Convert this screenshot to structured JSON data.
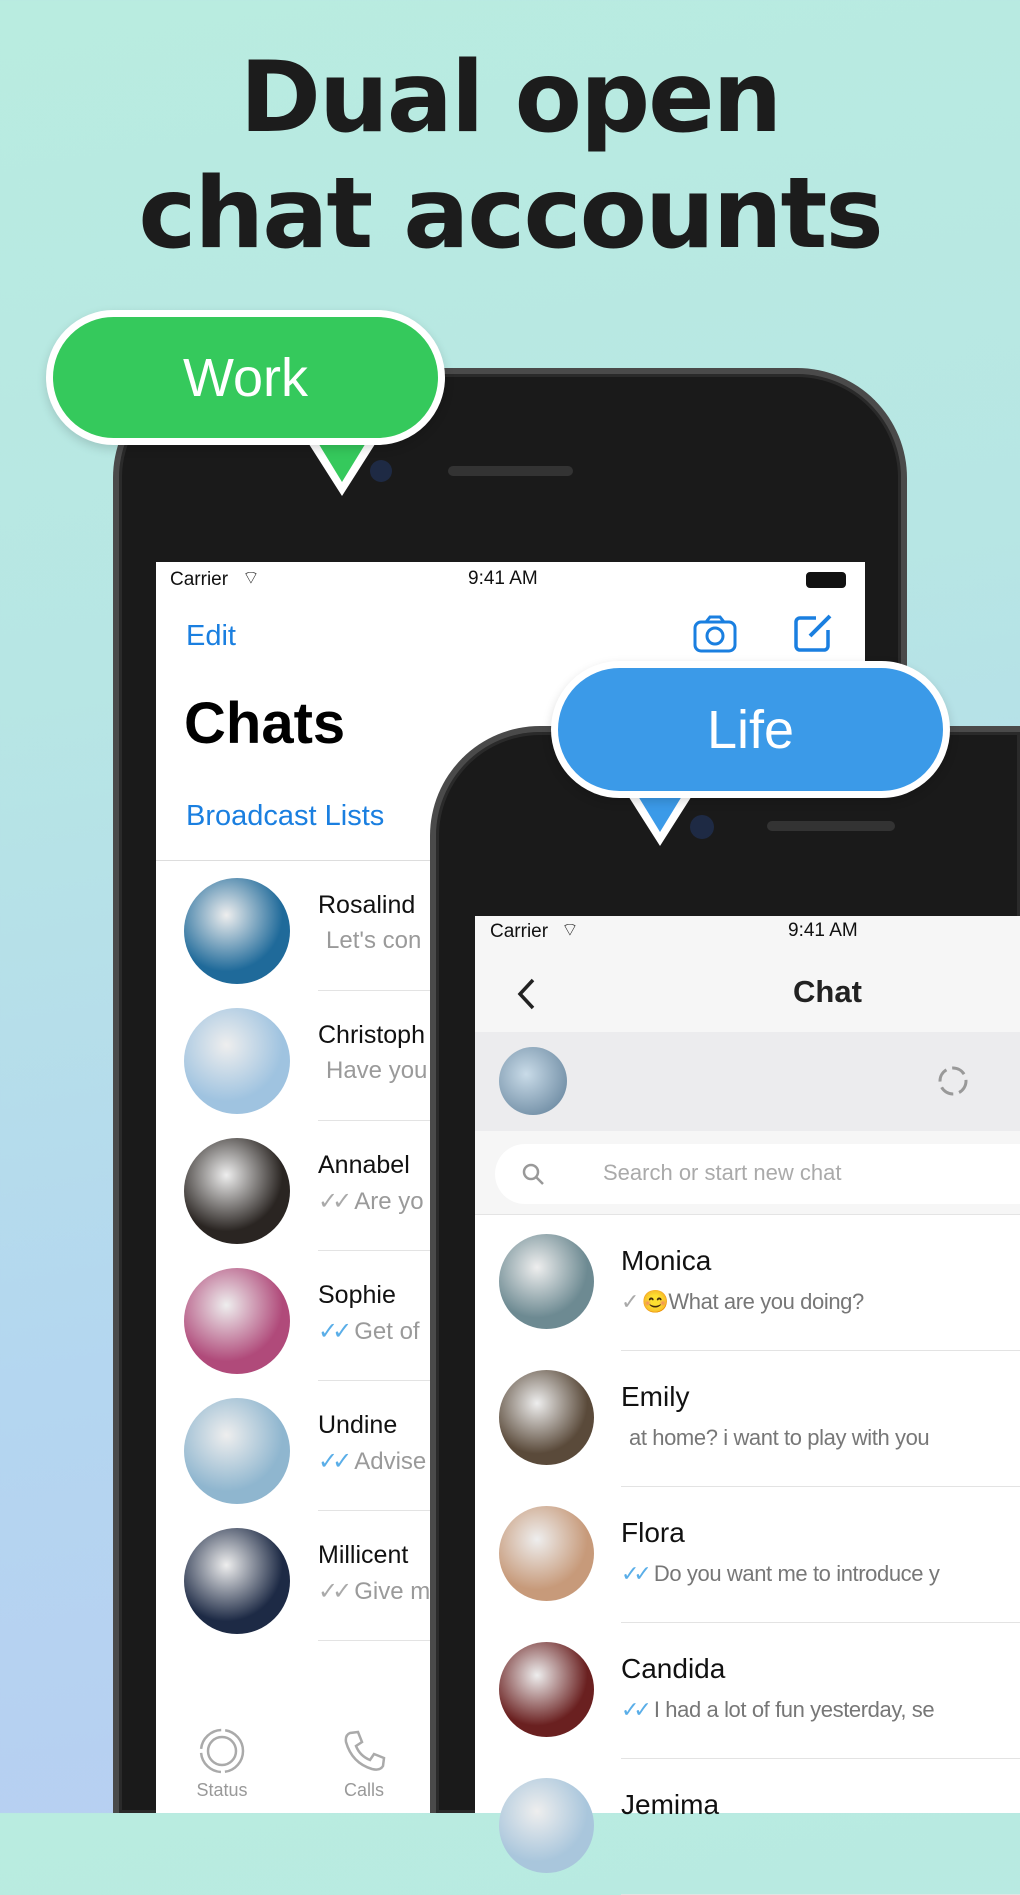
{
  "headline": {
    "line1": "Dual open",
    "line2": "chat accounts"
  },
  "badges": {
    "work": "Work",
    "life": "Life",
    "work_color": "#35c95c",
    "life_color": "#3b9ae8"
  },
  "work_phone": {
    "status": {
      "carrier": "Carrier",
      "time": "9:41 AM"
    },
    "edit": "Edit",
    "title": "Chats",
    "broadcast": "Broadcast Lists",
    "chats": [
      {
        "name": "Rosalind",
        "message": "Let's con",
        "check": "",
        "color": "#1f6a9a"
      },
      {
        "name": "Christoph",
        "message": "Have you",
        "check": "",
        "color": "#9fc3e0"
      },
      {
        "name": "Annabel",
        "message": "Are yo",
        "check": "✓✓",
        "check_read": false,
        "color": "#2a2522"
      },
      {
        "name": "Sophie",
        "message": "Get of",
        "check": "✓✓",
        "check_read": true,
        "color": "#b04a7a"
      },
      {
        "name": "Undine",
        "message": "Advise",
        "check": "✓✓",
        "check_read": true,
        "color": "#8fb6cf"
      },
      {
        "name": "Millicent",
        "message": "Give m",
        "check": "✓✓",
        "check_read": false,
        "color": "#1d2a45"
      }
    ],
    "tabs": [
      {
        "label": "Status",
        "icon": "status-icon"
      },
      {
        "label": "Calls",
        "icon": "phone-icon"
      }
    ]
  },
  "life_phone": {
    "status": {
      "carrier": "Carrier",
      "time": "9:41 AM"
    },
    "title": "Chat",
    "search_placeholder": "Search or start new chat",
    "chats": [
      {
        "name": "Monica",
        "message": "😊What are you doing?",
        "check": "✓",
        "check_read": false,
        "color": "#6d8a92"
      },
      {
        "name": "Emily",
        "message": "at home? i want to play with you",
        "check": "",
        "color": "#5a4a3a"
      },
      {
        "name": "Flora",
        "message": "Do you want me to introduce y",
        "check": "✓✓",
        "check_read": true,
        "color": "#c79a7a"
      },
      {
        "name": "Candida",
        "message": "I had a lot of fun yesterday, se",
        "check": "✓✓",
        "check_read": true,
        "color": "#6a2020"
      },
      {
        "name": "Jemima",
        "message": "",
        "check": "",
        "color": "#a9c6dc"
      }
    ]
  }
}
